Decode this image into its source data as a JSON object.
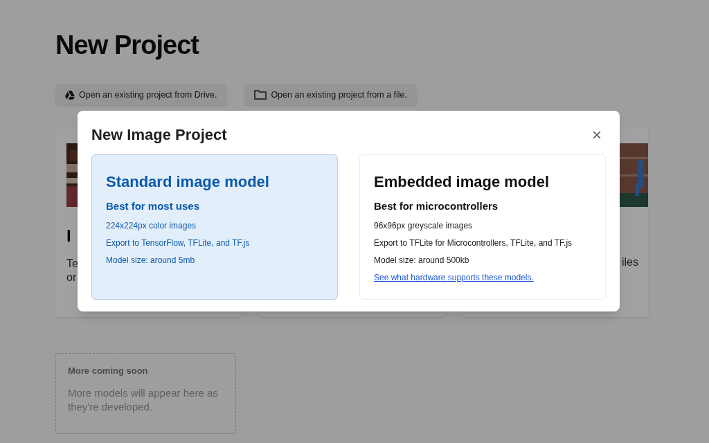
{
  "page": {
    "title": "New Project",
    "open_buttons": [
      {
        "kind": "drive",
        "label": "Open an existing project from Drive."
      },
      {
        "kind": "file",
        "label": "Open an existing project from a file."
      }
    ],
    "cards": [
      {
        "title": "I",
        "body": [
          "Te",
          "or"
        ],
        "kind": "picture"
      },
      {
        "kind": "plain"
      },
      {
        "body_right": "iles",
        "kind": "picture"
      }
    ],
    "coming_soon": {
      "title": "More coming soon",
      "text": "More models will appear here as they're developed."
    }
  },
  "dialog": {
    "title": "New Image Project",
    "close": "×",
    "options": [
      {
        "selected": true,
        "title": "Standard image model",
        "subtitle": "Best for most uses",
        "lines": [
          "224x224px color images",
          "Export to TensorFlow, TFLite, and TF.js",
          "Model size: around 5mb"
        ]
      },
      {
        "selected": false,
        "title": "Embedded image model",
        "subtitle": "Best for microcontrollers",
        "lines": [
          "96x96px greyscale images",
          "Export to TFLite for Microcontrollers, TFLite, and TF.js",
          "Model size: around 500kb"
        ],
        "link": "See what hardware supports these models."
      }
    ]
  }
}
